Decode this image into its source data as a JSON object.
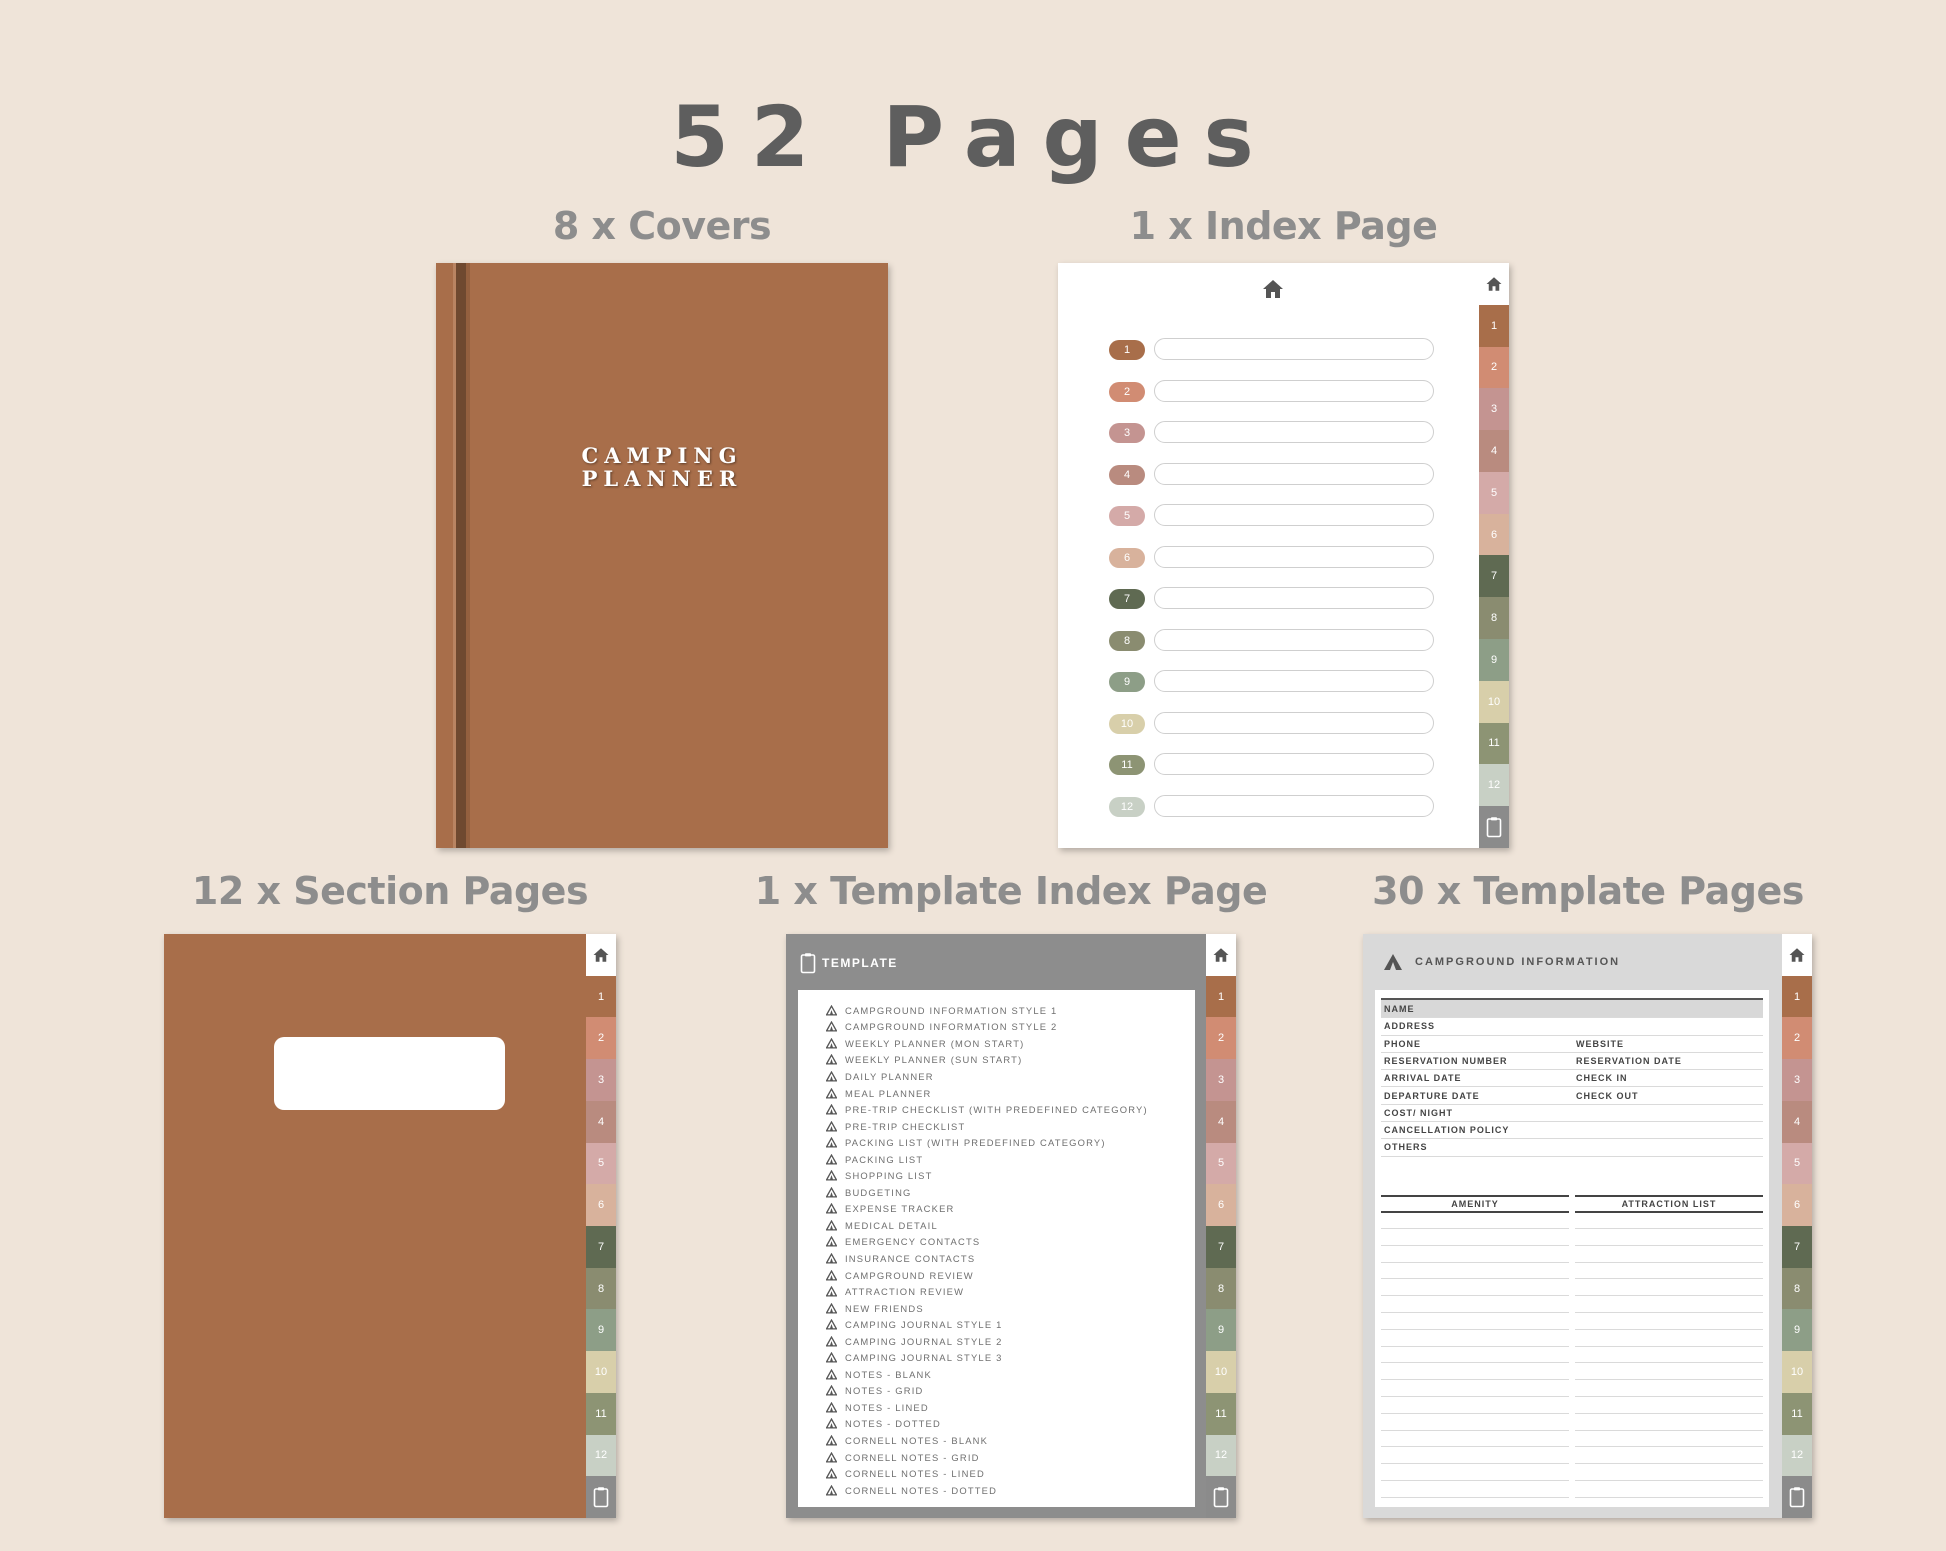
{
  "title": "52 Pages",
  "labels": {
    "covers": "8 x Covers",
    "index_page": "1 x Index Page",
    "section_pages": "12 x Section Pages",
    "template_index_page": "1 x Template Index Page",
    "template_pages": "30 x Template Pages"
  },
  "cover": {
    "title_line1": "CAMPING",
    "title_line2": "PLANNER",
    "color": "#a86e4a"
  },
  "tabs": [
    {
      "label": "1",
      "color": "#a86e4a"
    },
    {
      "label": "2",
      "color": "#d18c73"
    },
    {
      "label": "3",
      "color": "#c49491"
    },
    {
      "label": "4",
      "color": "#b98b7f"
    },
    {
      "label": "5",
      "color": "#d4aaa8"
    },
    {
      "label": "6",
      "color": "#d8b29c"
    },
    {
      "label": "7",
      "color": "#5f6a52"
    },
    {
      "label": "8",
      "color": "#8a8c70"
    },
    {
      "label": "9",
      "color": "#8d9e87"
    },
    {
      "label": "10",
      "color": "#d8cfaa"
    },
    {
      "label": "11",
      "color": "#8d9474"
    },
    {
      "label": "12",
      "color": "#c8d0c5"
    }
  ],
  "template_index": {
    "header": "TEMPLATE",
    "items": [
      "CAMPGROUND INFORMATION STYLE 1",
      "CAMPGROUND INFORMATION STYLE 2",
      "WEEKLY PLANNER (MON START)",
      "WEEKLY PLANNER (SUN START)",
      "DAILY PLANNER",
      "MEAL PLANNER",
      "PRE-TRIP CHECKLIST (WITH PREDEFINED CATEGORY)",
      "PRE-TRIP CHECKLIST",
      "PACKING LIST (WITH PREDEFINED CATEGORY)",
      "PACKING LIST",
      "SHOPPING LIST",
      "BUDGETING",
      "EXPENSE TRACKER",
      "MEDICAL DETAIL",
      "EMERGENCY CONTACTS",
      "INSURANCE CONTACTS",
      "CAMPGROUND REVIEW",
      "ATTRACTION REVIEW",
      "NEW FRIENDS",
      "CAMPING JOURNAL STYLE 1",
      "CAMPING JOURNAL STYLE 2",
      "CAMPING JOURNAL STYLE 3",
      "NOTES - BLANK",
      "NOTES - GRID",
      "NOTES - LINED",
      "NOTES - DOTTED",
      "CORNELL NOTES - BLANK",
      "CORNELL NOTES - GRID",
      "CORNELL NOTES - LINED",
      "CORNELL NOTES - DOTTED"
    ]
  },
  "template_page": {
    "header": "CAMPGROUND INFORMATION",
    "fields": [
      {
        "left": "NAME",
        "right": ""
      },
      {
        "left": "ADDRESS",
        "right": ""
      },
      {
        "left": "PHONE",
        "right": "WEBSITE"
      },
      {
        "left": "RESERVATION NUMBER",
        "right": "RESERVATION DATE"
      },
      {
        "left": "ARRIVAL DATE",
        "right": "CHECK IN"
      },
      {
        "left": "DEPARTURE DATE",
        "right": "CHECK OUT"
      },
      {
        "left": "COST/ NIGHT",
        "right": ""
      },
      {
        "left": "CANCELLATION POLICY",
        "right": ""
      },
      {
        "left": "OTHERS",
        "right": ""
      }
    ],
    "col_left": "AMENITY",
    "col_right": "ATTRACTION LIST"
  }
}
